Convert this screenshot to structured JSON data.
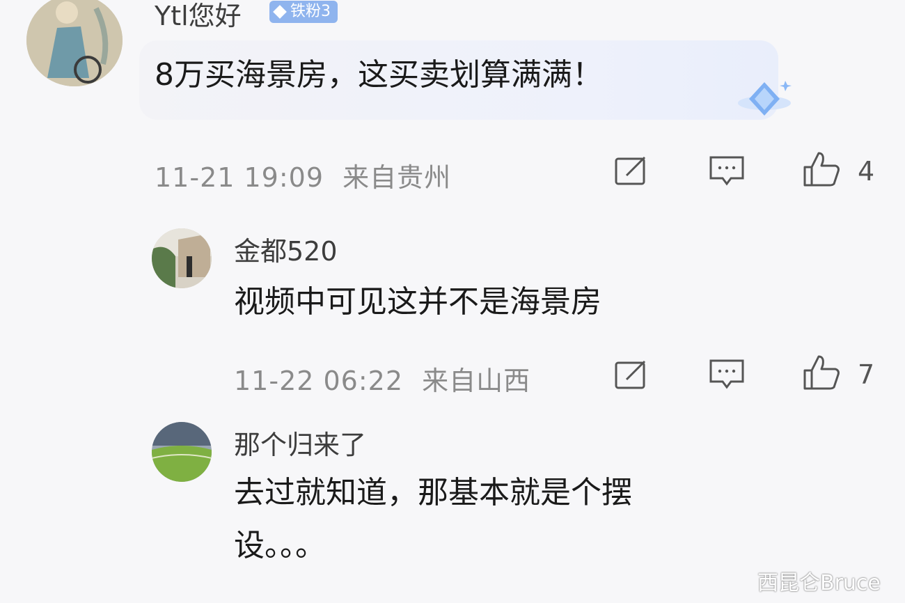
{
  "comments": [
    {
      "username": "Ytl您好",
      "badge": "铁粉3",
      "text": "8万买海景房，这买卖划算满满！",
      "time": "11-21 19:09",
      "location": "来自贵州",
      "likes": "4"
    },
    {
      "username": "金都520",
      "text": "视频中可见这并不是海景房",
      "time": "11-22 06:22",
      "location": "来自山西",
      "likes": "7"
    },
    {
      "username": "那个归来了",
      "text_line1": "去过就知道，那基本就是个摆",
      "text_line2": "设。。。"
    }
  ],
  "watermark": "西昆仑Bruce",
  "icons": [
    "edit-icon",
    "reply-icon",
    "like-icon",
    "diamond-sticker-icon"
  ],
  "colors": {
    "background": "#f7f7f9",
    "badge": "#8fb4ee",
    "meta_text": "#8a8a8a"
  }
}
